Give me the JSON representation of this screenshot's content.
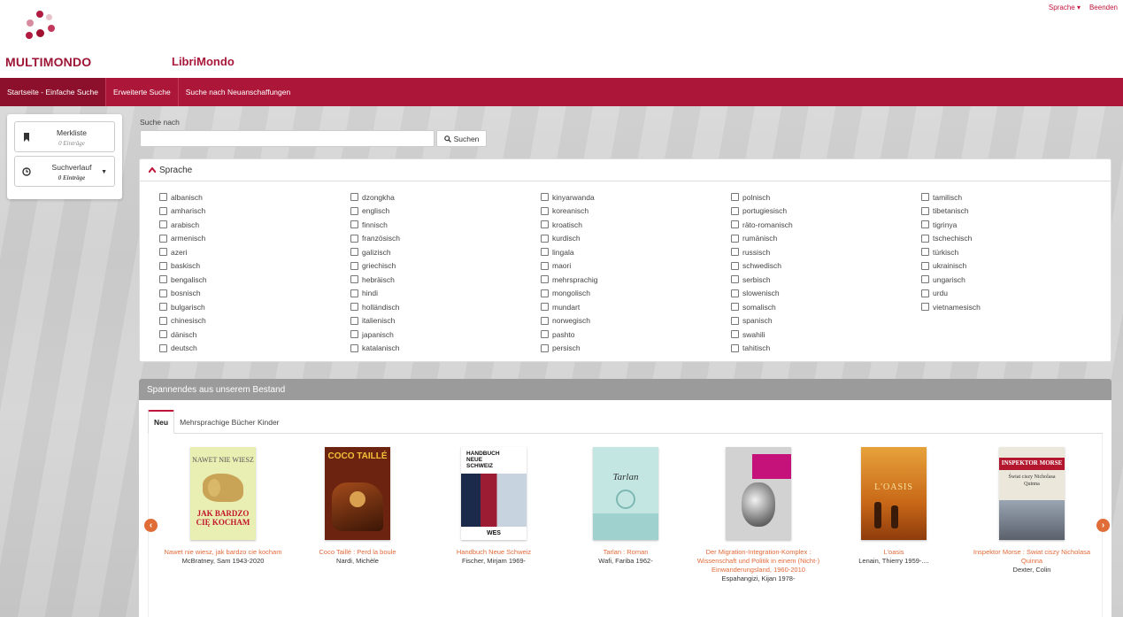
{
  "brand": {
    "logo_text": "MULTIMONDO",
    "app_title": "LibriMondo",
    "accent": "#ac1639"
  },
  "top_links": {
    "language": "Sprache ▾",
    "logout": "Beenden"
  },
  "nav": {
    "items": [
      {
        "label": "Startseite - Einfache Suche",
        "active": true
      },
      {
        "label": "Erweiterte Suche",
        "active": false
      },
      {
        "label": "Suche nach Neuanschaffungen",
        "active": false
      }
    ]
  },
  "sidebar": {
    "watchlist": {
      "title": "Merkliste",
      "count": "0 Einträge"
    },
    "history": {
      "title": "Suchverlauf",
      "count": "0 Einträge"
    }
  },
  "search": {
    "label": "Suche nach",
    "value": "",
    "button": "Suchen"
  },
  "language_panel": {
    "heading": "Sprache",
    "columns": [
      [
        "albanisch",
        "amharisch",
        "arabisch",
        "armenisch",
        "azeri",
        "baskisch",
        "bengalisch",
        "bosnisch",
        "bulgarisch",
        "chinesisch",
        "dänisch",
        "deutsch"
      ],
      [
        "dzongkha",
        "englisch",
        "finnisch",
        "französisch",
        "galizisch",
        "griechisch",
        "hebräisch",
        "hindi",
        "holländisch",
        "italienisch",
        "japanisch",
        "katalanisch"
      ],
      [
        "kinyarwanda",
        "koreanisch",
        "kroatisch",
        "kurdisch",
        "lingala",
        "maori",
        "mehrsprachig",
        "mongolisch",
        "mundart",
        "norwegisch",
        "pashto",
        "persisch"
      ],
      [
        "polnisch",
        "portugiesisch",
        "räto-romanisch",
        "rumänisch",
        "russisch",
        "schwedisch",
        "serbisch",
        "slowenisch",
        "somalisch",
        "spanisch",
        "swahili",
        "tahitisch"
      ],
      [
        "tamilisch",
        "tibetanisch",
        "tigrinya",
        "tschechisch",
        "türkisch",
        "ukrainisch",
        "ungarisch",
        "urdu",
        "vietnamesisch"
      ]
    ]
  },
  "featured": {
    "heading": "Spannendes aus unserem Bestand",
    "tabs": [
      {
        "label": "Neu",
        "active": true
      },
      {
        "label": "Mehrsprachige Bücher Kinder",
        "active": false
      }
    ],
    "books": [
      {
        "title": "Nawet nie wiesz, jak bardzo cie kocham",
        "author": "McBratney, Sam 1943-2020",
        "cover_text_top": "NAWET NIE WIESZ",
        "cover_text_bottom": "JAK BARDZO CIĘ KOCHAM",
        "cover_color": "#e8ecb0"
      },
      {
        "title": "Coco Taillé : Perd la boule",
        "author": "Nardi, Michèle",
        "cover_text_top": "COCO TAILLÉ",
        "cover_text_bottom": "",
        "cover_color": "#7a2a12"
      },
      {
        "title": "Handbuch Neue Schweiz",
        "author": "Fischer, Mirjam 1969-",
        "cover_text_top": "HANDBUCH NEUE SCHWEIZ",
        "cover_text_bottom": "WES",
        "cover_color": "#ffffff"
      },
      {
        "title": "Tarlan : Roman",
        "author": "Wafi, Fariba 1962-",
        "cover_text_top": "Tarlan",
        "cover_text_bottom": "",
        "cover_color": "#bfe3e0"
      },
      {
        "title": "Der Migration-Integration-Komplex : Wissenschaft und Politik in einem (Nicht-) Einwanderungsland, 1960-2010",
        "author": "Espahangizi, Kijan 1978-",
        "cover_text_top": "",
        "cover_text_bottom": "",
        "cover_color": "#d6d6d6"
      },
      {
        "title": "L'oasis",
        "author": "Lenain, Thierry 1959-....",
        "cover_text_top": "L'OASIS",
        "cover_text_bottom": "",
        "cover_color": "#d8801e"
      },
      {
        "title": "Inspektor Morse : Swiat ciszy Nicholasa Quinna",
        "author": "Dexter, Colin",
        "cover_text_top": "INSPEKTOR MORSE",
        "cover_text_bottom": "Świat ciszy Nicholasa Quinna",
        "cover_color": "#e8e4d8"
      }
    ],
    "prev_icon": "chevron-left-icon",
    "next_icon": "chevron-right-icon"
  }
}
